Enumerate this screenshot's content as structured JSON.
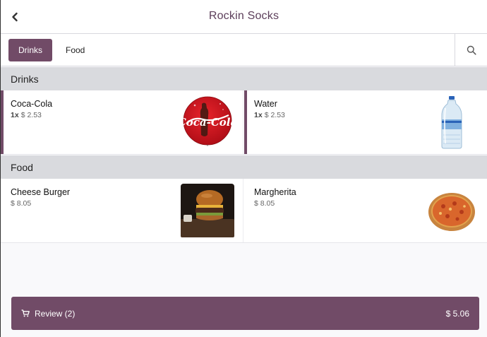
{
  "header": {
    "title": "Rockin Socks",
    "back_icon": "chevron-left-icon"
  },
  "tabs": [
    {
      "label": "Drinks",
      "active": true
    },
    {
      "label": "Food",
      "active": false
    }
  ],
  "search_icon": "search-icon",
  "sections": [
    {
      "title": "Drinks",
      "products": [
        {
          "name": "Coca-Cola",
          "qty": "1x",
          "price": "$ 2.53",
          "selected": true,
          "image": "coca-cola-logo"
        },
        {
          "name": "Water",
          "qty": "1x",
          "price": "$ 2.53",
          "selected": true,
          "image": "water-bottle"
        }
      ]
    },
    {
      "title": "Food",
      "products": [
        {
          "name": "Cheese Burger",
          "price": "$ 8.05",
          "selected": false,
          "image": "burger-photo"
        },
        {
          "name": "Margherita",
          "price": "$ 8.05",
          "selected": false,
          "image": "pizza-photo"
        }
      ]
    }
  ],
  "review": {
    "label": "Review (2)",
    "total": "$ 5.06",
    "icon": "shopping-cart-icon"
  },
  "colors": {
    "accent": "#714b67",
    "title": "#5c3e5a",
    "section_bg": "#d9dade"
  }
}
